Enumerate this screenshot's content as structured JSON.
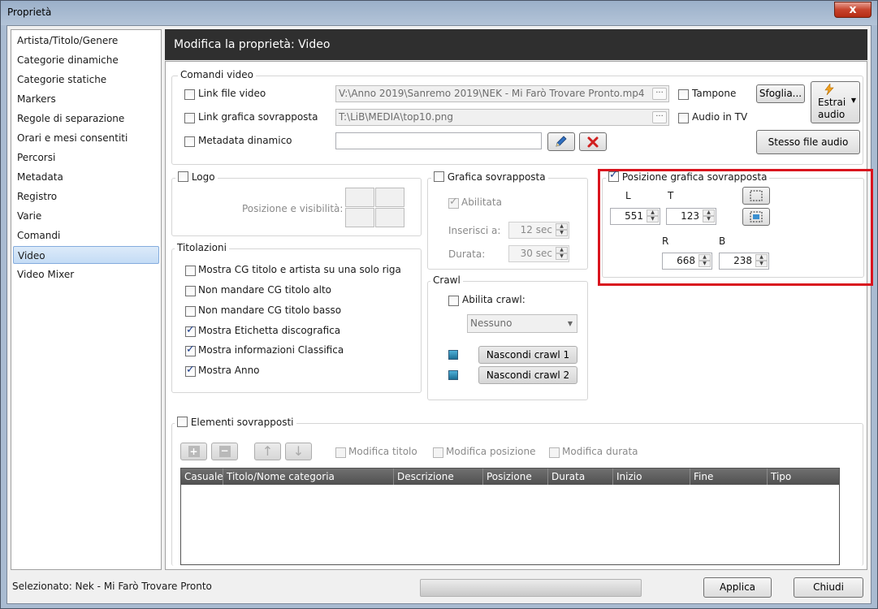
{
  "window": {
    "title": "Proprietà",
    "close_glyph": "x"
  },
  "sidebar": {
    "items": [
      {
        "label": "Artista/Titolo/Genere"
      },
      {
        "label": "Categorie dinamiche"
      },
      {
        "label": "Categorie statiche"
      },
      {
        "label": "Markers"
      },
      {
        "label": "Regole di separazione"
      },
      {
        "label": "Orari e mesi consentiti"
      },
      {
        "label": "Percorsi"
      },
      {
        "label": "Metadata"
      },
      {
        "label": "Registro"
      },
      {
        "label": "Varie"
      },
      {
        "label": "Comandi"
      },
      {
        "label": "Video"
      },
      {
        "label": "Video Mixer"
      }
    ],
    "selected": "Video"
  },
  "header": {
    "title": "Modifica la proprietà: Video"
  },
  "comandi_video": {
    "title": "Comandi video",
    "link_file_video": {
      "label": "Link file video",
      "checked": false,
      "value": "V:\\Anno 2019\\Sanremo 2019\\NEK - Mi Farò Trovare Pronto.mp4"
    },
    "link_grafica": {
      "label": "Link grafica sovrapposta",
      "checked": false,
      "value": "T:\\LiB\\MEDIA\\top10.png"
    },
    "metadata_dinamico": {
      "label": "Metadata dinamico",
      "checked": false,
      "value": ""
    },
    "browse_glyph": "···",
    "tampone": {
      "label": "Tampone",
      "checked": false
    },
    "audio_in_tv": {
      "label": "Audio in TV",
      "checked": false
    },
    "sfoglia_label": "Sfoglia...",
    "estrai_audio_label_1": "Estrai",
    "estrai_audio_label_2": "audio",
    "stesso_file_audio_label": "Stesso file audio"
  },
  "logo": {
    "title": "Logo",
    "checked": false,
    "posizione_label": "Posizione e visibilità:"
  },
  "grafica": {
    "title": "Grafica sovrapposta",
    "checked": false,
    "abilitata_label": "Abilitata",
    "abilitata_checked": true,
    "inserisci_label": "Inserisci a:",
    "inserisci_value": "12 sec",
    "durata_label": "Durata:",
    "durata_value": "30 sec"
  },
  "posizione": {
    "title": "Posizione grafica sovrapposta",
    "checked": true,
    "L_label": "L",
    "L_value": "551",
    "T_label": "T",
    "T_value": "123",
    "R_label": "R",
    "R_value": "668",
    "B_label": "B",
    "B_value": "238",
    "highlight_color": "#d9141e"
  },
  "titolazioni": {
    "title": "Titolazioni",
    "options": [
      {
        "label": "Mostra CG titolo e artista su una solo riga",
        "checked": false
      },
      {
        "label": "Non mandare CG titolo alto",
        "checked": false
      },
      {
        "label": "Non mandare CG titolo basso",
        "checked": false
      },
      {
        "label": "Mostra Etichetta discografica",
        "checked": true
      },
      {
        "label": "Mostra informazioni Classifica",
        "checked": true
      },
      {
        "label": "Mostra Anno",
        "checked": true
      }
    ]
  },
  "crawl": {
    "title": "Crawl",
    "abilita_label": "Abilita crawl:",
    "abilita_checked": false,
    "select_value": "Nessuno",
    "nascondi_1": "Nascondi crawl 1",
    "nascondi_2": "Nascondi crawl 2"
  },
  "elementi": {
    "title": "Elementi sovrapposti",
    "checked": false,
    "modifica_titolo": "Modifica titolo",
    "modifica_posizione": "Modifica posizione",
    "modifica_durata": "Modifica durata",
    "columns": [
      "Casuale",
      "Titolo/Nome categoria",
      "Descrizione",
      "Posizione",
      "Durata",
      "Inizio",
      "Fine",
      "Tipo"
    ],
    "rows": []
  },
  "footer": {
    "status_text": "Selezionato: Nek - Mi Farò Trovare Pronto",
    "applica_label": "Applica",
    "chiudi_label": "Chiudi"
  }
}
